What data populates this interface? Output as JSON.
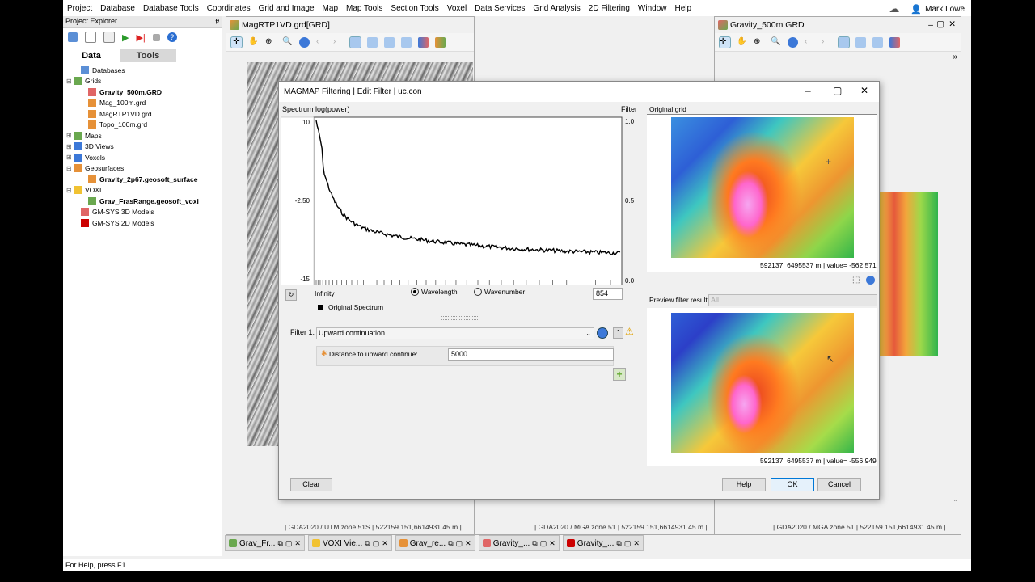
{
  "menu": [
    "Project",
    "Database",
    "Database Tools",
    "Coordinates",
    "Grid and Image",
    "Map",
    "Map Tools",
    "Section Tools",
    "Voxel",
    "Data Services",
    "Grid Analysis",
    "2D Filtering",
    "Window",
    "Help"
  ],
  "user": "Mark Lowe",
  "explorer": {
    "title": "Project Explorer",
    "pin": "ᵽ",
    "tabs": [
      "Data",
      "Tools"
    ],
    "tree": [
      {
        "label": "Databases",
        "exp": "",
        "indent": 1,
        "bold": false,
        "color": "#5b8fd6"
      },
      {
        "label": "Grids",
        "exp": "⊟",
        "indent": 0,
        "bold": false,
        "color": "#6aa84f"
      },
      {
        "label": "Gravity_500m.GRD",
        "exp": "",
        "indent": 2,
        "bold": true,
        "color": "#e06666"
      },
      {
        "label": "Mag_100m.grd",
        "exp": "",
        "indent": 2,
        "bold": false,
        "color": "#e69138"
      },
      {
        "label": "MagRTP1VD.grd",
        "exp": "",
        "indent": 2,
        "bold": false,
        "color": "#e69138"
      },
      {
        "label": "Topo_100m.grd",
        "exp": "",
        "indent": 2,
        "bold": false,
        "color": "#e69138"
      },
      {
        "label": "Maps",
        "exp": "⊞",
        "indent": 0,
        "bold": false,
        "color": "#6aa84f"
      },
      {
        "label": "3D Views",
        "exp": "⊞",
        "indent": 0,
        "bold": false,
        "color": "#3c78d8"
      },
      {
        "label": "Voxels",
        "exp": "⊞",
        "indent": 0,
        "bold": false,
        "color": "#3c78d8"
      },
      {
        "label": "Geosurfaces",
        "exp": "⊟",
        "indent": 0,
        "bold": false,
        "color": "#e69138"
      },
      {
        "label": "Gravity_2p67.geosoft_surface",
        "exp": "",
        "indent": 2,
        "bold": true,
        "color": "#e69138"
      },
      {
        "label": "VOXI",
        "exp": "⊟",
        "indent": 0,
        "bold": false,
        "color": "#f1c232"
      },
      {
        "label": "Grav_FrasRange.geosoft_voxi",
        "exp": "",
        "indent": 2,
        "bold": true,
        "color": "#6aa84f"
      },
      {
        "label": "GM-SYS 3D Models",
        "exp": "",
        "indent": 1,
        "bold": false,
        "color": "#e06666"
      },
      {
        "label": "GM-SYS 2D Models",
        "exp": "",
        "indent": 1,
        "bold": false,
        "color": "#cc0000"
      }
    ]
  },
  "doc1": {
    "title": "MagRTP1VD.grd[GRD]",
    "status": "| GDA2020 / UTM zone 51S  | 522159.151,6614931.45 m |"
  },
  "doc2": {
    "status": "| GDA2020 / MGA zone 51  | 522159.151,6614931.45 m |"
  },
  "doc3": {
    "title": "Gravity_500m.GRD",
    "status": "| GDA2020 / MGA zone 51  | 522159.151,6614931.45 m |"
  },
  "dialog": {
    "title": "MAGMAP Filtering | Edit Filter | uc.con",
    "spectrum_label": "Spectrum log(power)",
    "filter_label": "Filter",
    "y_ticks": [
      "10",
      "-2.50",
      "-15"
    ],
    "f_ticks": [
      "1.0",
      "0.5",
      "0.0"
    ],
    "infinity": "Infinity",
    "radio_wavelength": "Wavelength",
    "radio_wavenumber": "Wavenumber",
    "wavelength_value": "854",
    "legend": "Original Spectrum",
    "filter_row_label": "Filter 1:",
    "filter_value": "Upward continuation",
    "param_label": "Distance to upward continue:",
    "param_value": "5000",
    "original_grid_label": "Original grid",
    "original_readout": "592137, 6495537 m |  value= -562.571",
    "preview_label": "Preview filter result:",
    "preview_select": "All",
    "preview_readout": "592137, 6495537 m |  value= -556.949",
    "buttons": {
      "clear": "Clear",
      "help": "Help",
      "ok": "OK",
      "cancel": "Cancel"
    }
  },
  "taskbar": [
    {
      "label": "Grav_Fr...",
      "color": "#6aa84f"
    },
    {
      "label": "VOXI Vie...",
      "color": "#f1c232"
    },
    {
      "label": "Grav_re...",
      "color": "#e69138"
    },
    {
      "label": "Gravity_...",
      "color": "#e06666"
    },
    {
      "label": "Gravity_...",
      "color": "#cc0000"
    }
  ],
  "statusbar": "For Help, press F1"
}
